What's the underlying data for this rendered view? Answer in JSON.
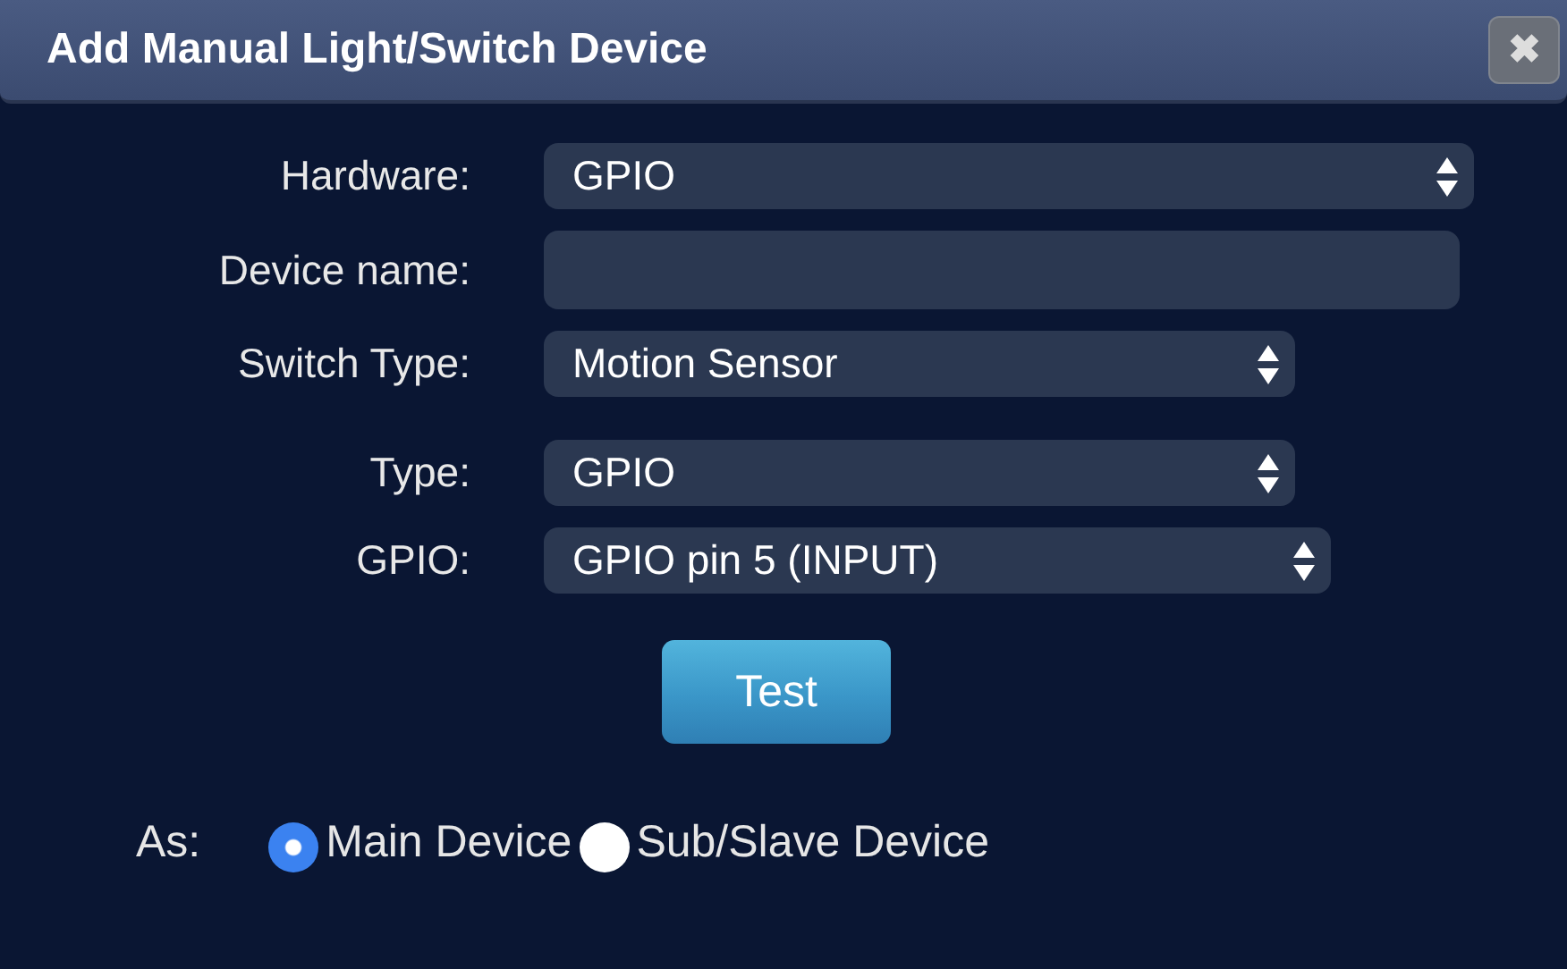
{
  "dialog": {
    "title": "Add Manual Light/Switch Device",
    "close": "✖"
  },
  "fields": [
    {
      "label": "Hardware:",
      "kind": "select",
      "value": "GPIO"
    },
    {
      "label": "Device name:",
      "kind": "text"
    },
    {
      "label": "Switch Type:",
      "kind": "select",
      "value": "Motion Sensor"
    },
    {
      "label": "Type:",
      "kind": "select",
      "value": "GPIO"
    },
    {
      "label": "GPIO:",
      "kind": "select",
      "value": "GPIO pin 5 (INPUT)"
    }
  ],
  "test_button": "Test",
  "as": {
    "label": "As:",
    "options": [
      {
        "label": "Main Device",
        "selected": true
      },
      {
        "label": "Sub/Slave Device",
        "selected": false
      }
    ]
  }
}
